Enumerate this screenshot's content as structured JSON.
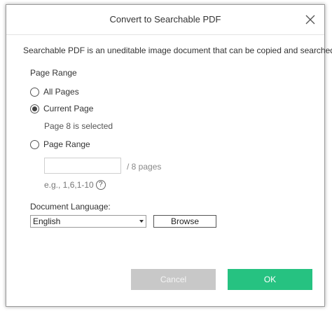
{
  "dialog": {
    "title": "Convert to Searchable PDF",
    "close_icon": "close-icon",
    "description": "Searchable PDF is an uneditable image document that can be copied and searched."
  },
  "page_range": {
    "section_label": "Page Range",
    "options": [
      {
        "label": "All Pages",
        "checked": false
      },
      {
        "label": "Current Page",
        "checked": true
      },
      {
        "label": "Page Range",
        "checked": false
      }
    ],
    "current_page_note": "Page 8 is selected",
    "range_input_value": "",
    "total_pages_label": "/ 8 pages",
    "example": "e.g., 1,6,1-10",
    "help_icon": "help-icon",
    "help_glyph": "?"
  },
  "language": {
    "section_label": "Document Language:",
    "selected": "English",
    "browse_label": "Browse"
  },
  "footer": {
    "cancel_label": "Cancel",
    "ok_label": "OK"
  },
  "colors": {
    "ok_button": "#26c281",
    "cancel_button": "#c8c8c8"
  }
}
